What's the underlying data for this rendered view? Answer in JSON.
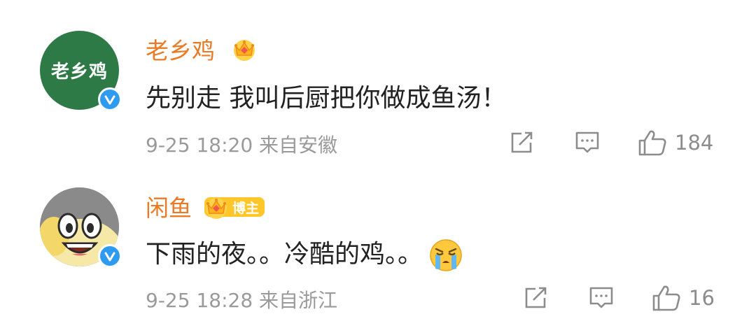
{
  "comments": [
    {
      "avatar_text": "老乡鸡",
      "avatar_icon": "brand-logo-icon",
      "username": "老乡鸡",
      "badge_icon": "crown-icon",
      "badge_text": "",
      "text": "先别走 我叫后厨把你做成鱼汤！",
      "emoji_icon": "",
      "meta": "9-25 18:20 来自安徽",
      "likes": "184"
    },
    {
      "avatar_text": "",
      "avatar_icon": "cartoon-fish-avatar",
      "username": "闲鱼",
      "badge_icon": "crown-icon",
      "badge_text": "博主",
      "text": "下雨的夜。。冷酷的鸡。。",
      "emoji_icon": "crying-face-emoji",
      "meta": "9-25 18:28 来自浙江",
      "likes": "16"
    }
  ],
  "colors": {
    "username": "#ea7b24",
    "meta": "#9a9a9a",
    "text": "#222222",
    "verified": "#2f9bf0",
    "brand_green": "#2e7a47",
    "badge_gold": "#ffc629"
  }
}
